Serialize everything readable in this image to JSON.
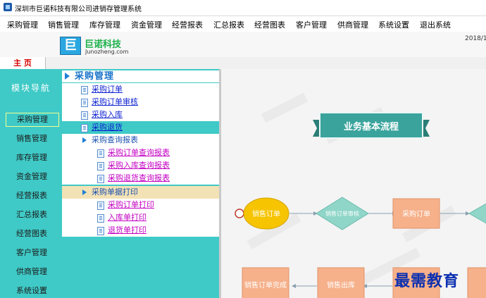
{
  "window": {
    "title": "深圳市巨诺科技有限公司进销存管理系统"
  },
  "menu": [
    "采购管理",
    "销售管理",
    "库存管理",
    "资金管理",
    "经营报表",
    "汇总报表",
    "经营图表",
    "客户管理",
    "供商管理",
    "系统设置",
    "退出系统"
  ],
  "header": {
    "logo_glyph": "巨",
    "logo_name": "巨诺科技",
    "logo_domain": "Junozheng.com",
    "date": "2018/1"
  },
  "tabs": {
    "home": "主 页"
  },
  "nav": {
    "title": "模块导航",
    "items": [
      "采购管理",
      "销售管理",
      "库存管理",
      "资金管理",
      "经营报表",
      "汇总报表",
      "经营图表",
      "客户管理",
      "供商管理",
      "系统设置"
    ],
    "active_index": 0
  },
  "tree": {
    "header": "采购管理",
    "items": [
      "采购订单",
      "采购订单审核",
      "采购入库",
      "采购退货"
    ],
    "groups": [
      {
        "label": "采购查询报表",
        "items": [
          "采购订单查询报表",
          "采购入库查询报表",
          "采购退货查询报表"
        ]
      },
      {
        "label": "采购单据打印",
        "items": [
          "采购订单打印",
          "入库单打印",
          "退货单打印"
        ]
      }
    ]
  },
  "flow": {
    "banner": "业务基本流程",
    "nodes": {
      "start": "销售订单",
      "review": "销售订单审核",
      "purchase": "采购订单",
      "sales_out": "销售出库",
      "order_done": "销售订单完成"
    }
  },
  "watermark": "最需教育",
  "colors": {
    "accent": "#3fcac7",
    "banner": "#3aa39c",
    "flow_box": "#f6b08a",
    "flow_diamond": "#8fd6c8",
    "start_ellipse": "#f6c400",
    "link": "#0b1fd0",
    "link_visited": "#c300c3"
  }
}
